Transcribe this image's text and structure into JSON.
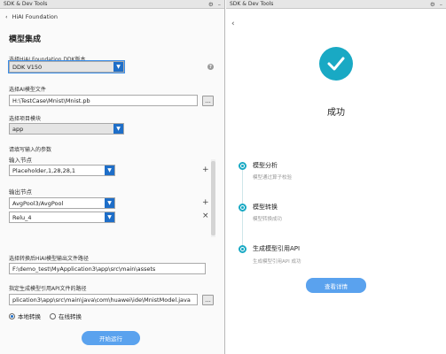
{
  "left": {
    "window_title": "SDK & Dev Tools",
    "breadcrumb": "HiAI Foundation",
    "page_title": "模型集成",
    "ddk_label": "选择HiAI Foundation DDK版本",
    "ddk_value": "DDK V150",
    "ai_model_label": "选择AI模型文件",
    "ai_model_value": "H:\\TestCase\\Mnist\\Mnist.pb",
    "project_module_label": "选择项目模块",
    "project_module_value": "app",
    "params_label": "请填写输入的参数",
    "input_node_label": "输入节点",
    "input_node_value": "Placeholder,1,28,28,1",
    "output_node_label": "输出节点",
    "output_nodes": [
      "AvgPool3/AvgPool",
      "Relu_4"
    ],
    "convert_path_label": "选择转换后HiAI模型输出文件路径",
    "convert_path_value": "F:\\demo_test\\MyApplication3\\app\\src\\main\\assets",
    "api_path_label": "指定生成模型引用API文件的路径",
    "api_path_value": "plication3\\app\\src\\main\\java\\com\\huawei\\ide\\MnistModel.java",
    "radio_local": "本地转换",
    "radio_online": "在线转换",
    "start_button": "开始运行",
    "browse_label": "..."
  },
  "right": {
    "window_title": "SDK & Dev Tools",
    "success_title": "成功",
    "steps": [
      {
        "title": "模型分析",
        "desc": "模型通过算子校验"
      },
      {
        "title": "模型转换",
        "desc": "模型转换成功"
      },
      {
        "title": "生成模型引用API",
        "desc": "生成模型引用API 成功"
      }
    ],
    "detail_button": "查看详情"
  },
  "colors": {
    "accent": "#19a9c4",
    "button": "#5aa2ee",
    "select_caret": "#1e6ec8"
  }
}
